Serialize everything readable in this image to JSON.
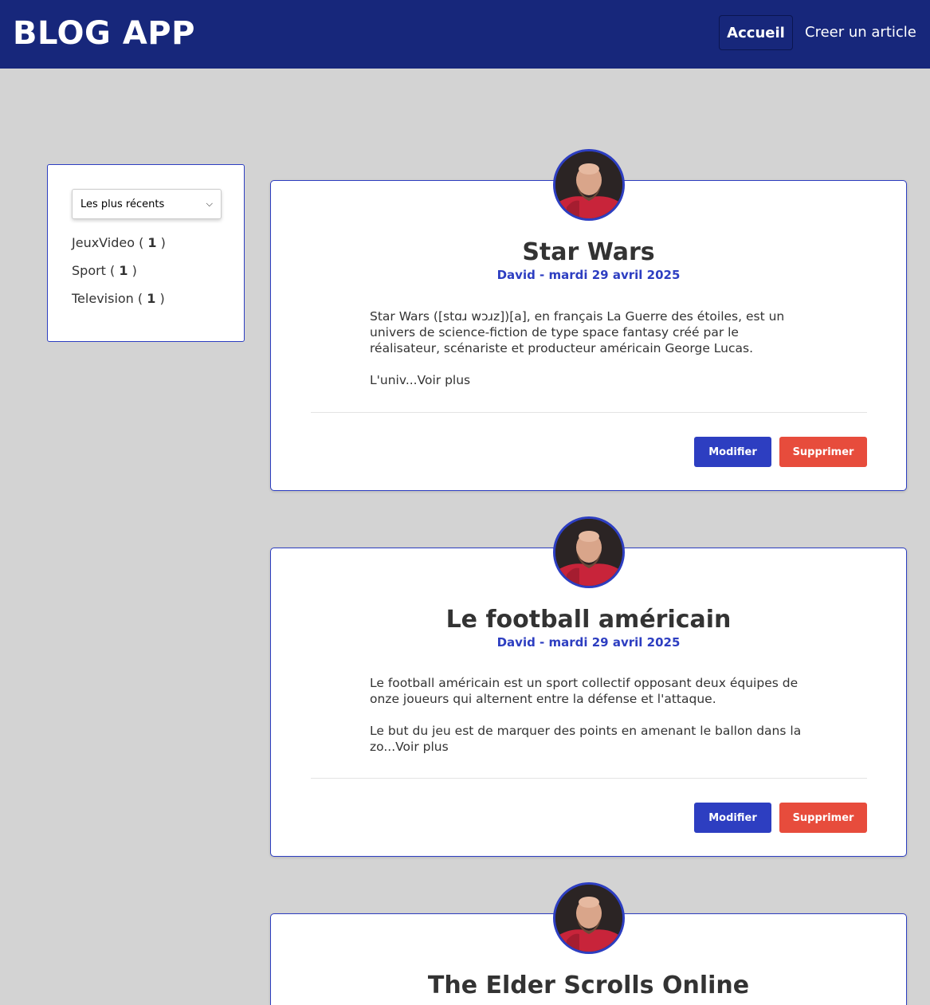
{
  "header": {
    "brand": "BLOG APP",
    "nav": {
      "home": "Accueil",
      "create": "Creer un article"
    }
  },
  "sidebar": {
    "sort_selected": "Les plus récents",
    "categories": [
      {
        "name": "JeuxVideo",
        "count": "1"
      },
      {
        "name": "Sport",
        "count": "1"
      },
      {
        "name": "Television",
        "count": "1"
      }
    ]
  },
  "articles": [
    {
      "title": "Star Wars",
      "meta": "David - mardi 29 avril 2025",
      "paragraphs": [
        "Star Wars ([stɑɹ wɔɹz])[a], en français La Guerre des étoiles, est un univers de science-fiction de type space fantasy créé par le réalisateur, scénariste et producteur américain George Lucas.",
        "L'univ...Voir plus"
      ],
      "edit_label": "Modifier",
      "delete_label": "Supprimer"
    },
    {
      "title": "Le football américain",
      "meta": "David - mardi 29 avril 2025",
      "paragraphs": [
        "Le football américain est un sport collectif opposant deux équipes de onze joueurs qui alternent entre la défense et l'attaque.",
        "Le but du jeu est de marquer des points en amenant le ballon dans la zo...Voir plus"
      ],
      "edit_label": "Modifier",
      "delete_label": "Supprimer"
    },
    {
      "title": "The Elder Scrolls Online"
    }
  ],
  "colors": {
    "header_bg": "#17277b",
    "accent": "#2d3ec1",
    "danger": "#e74c3c",
    "page_bg": "#d3d3d3"
  },
  "icons": [
    "chevron-down-icon",
    "author-avatar"
  ]
}
